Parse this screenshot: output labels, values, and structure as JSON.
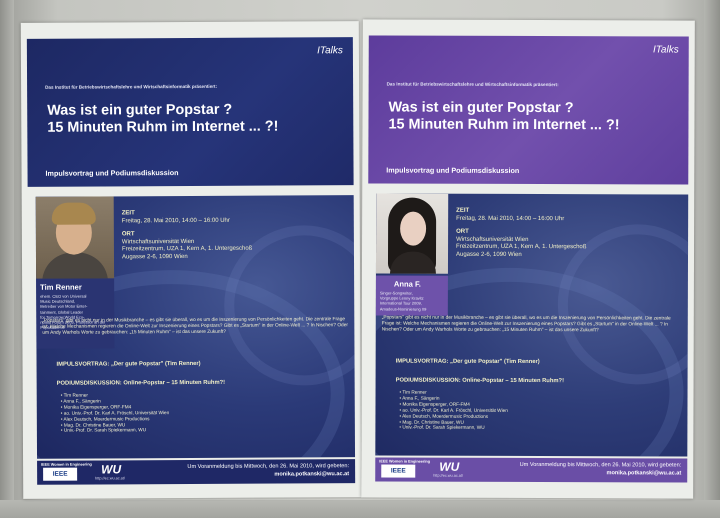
{
  "posters": [
    {
      "brand": "ITalks",
      "intro": "Das Institut für Betriebswirtschaftslehre und Wirtschaftsinformatik präsentiert:",
      "title_line1": "Was ist ein guter Popstar ?",
      "title_line2": "15 Minuten Ruhm im Internet ... ?!",
      "subtitle": "Impulsvortrag und Podiumsdiskussion",
      "speaker_name": "Tim Renner",
      "speaker_bio": "ehem. CEO von Universal\nMusic Deutschland,\nBetreiber von Motor Enter-\ntainment, Global Leader\nfor Tomorrow World Eco-\nnomic Forum 2005, Professor an der Popakademie",
      "zeit_label": "ZEIT",
      "zeit_value": "Freitag, 28. Mai 2010, 14:00 – 16:00 Uhr",
      "ort_label": "ORT",
      "ort_line1": "Wirtschaftsuniversität Wien",
      "ort_line2": "Freizeitzentrum, UZA 1, Kern A, 1. Untergeschoß",
      "ort_line3": "Augasse 2-6, 1090 Wien",
      "paragraph": "„Popstars\" gibt es nicht nur in der Musikbranche – es gibt sie überall, wo es um die Inszenierung von Persönlichkeiten geht. Die zentrale Frage ist: Welche Mechanismen regieren die Online-Welt zur Inszenierung eines Popstars? Gibt es „Startum\" in der Online-Welt ... ? In Nischen? Oder um Andy Warhols Worte zu gebrauchen: „15 Minuten Ruhm\" – ist das unsere Zukunft?",
      "impuls": "IMPULSVORTRAG: „Der gute Popstar\" (Tim Renner)",
      "podium": "PODIUMSDISKUSSION: Online-Popstar – 15 Minuten Ruhm?!",
      "panel": [
        "Tim Renner",
        "Anna F., Sängerin",
        "Monika Eigensperger, ORF-FM4",
        "ao. Univ.-Prof. Dr. Karl A. Fröschl, Universität Wien",
        "Alex Deutsch, Moerdermusic Productions",
        "Mag. Dr. Christine Bauer, WU",
        "Univ.-Prof. Dr. Sarah Spiekermann, WU"
      ],
      "ieee_small": "IEEE Women in Engineering",
      "ieee": "IEEE",
      "wu": "WU",
      "url": "http://ec.wu.ac.at/",
      "reg_text": "Um Voranmeldung bis Mittwoch, den 26. Mai 2010, wird gebeten:",
      "reg_mail": "monika.potkanski@wu.ac.at"
    },
    {
      "brand": "ITalks",
      "intro": "Das Institut für Betriebswirtschaftslehre und Wirtschaftsinformatik präsentiert:",
      "title_line1": "Was ist ein guter Popstar ?",
      "title_line2": "15 Minuten Ruhm im Internet ... ?!",
      "subtitle": "Impulsvortrag und Podiumsdiskussion",
      "speaker_name": "Anna F.",
      "speaker_bio": "Singer-Songwriter,\nVorgruppe Lenny Kravitz\nInternational Tour 2009,\nAmadeus-Nominierung 09",
      "zeit_label": "ZEIT",
      "zeit_value": "Freitag, 28. Mai 2010, 14:00 – 16:00 Uhr",
      "ort_label": "ORT",
      "ort_line1": "Wirtschaftsuniversität Wien",
      "ort_line2": "Freizeitzentrum, UZA 1, Kern A, 1. Untergeschoß",
      "ort_line3": "Augasse 2-6, 1090 Wien",
      "paragraph": "„Popstars\" gibt es nicht nur in der Musikbranche – es gibt sie überall, wo es um die Inszenierung von Persönlichkeiten geht. Die zentrale Frage ist: Welche Mechanismen regieren die Online-Welt zur Inszenierung eines Popstars? Gibt es „Startum\" in der Online-Welt ... ? In Nischen? Oder um Andy Warhols Worte zu gebrauchen: „15 Minuten Ruhm\" – ist das unsere Zukunft?",
      "impuls": "IMPULSVORTRAG: „Der gute Popstar\" (Tim Renner)",
      "podium": "PODIUMSDISKUSSION: Online-Popstar – 15 Minuten Ruhm?!",
      "panel": [
        "Tim Renner",
        "Anna F., Sängerin",
        "Monika Eigensperger, ORF-FM4",
        "ao. Univ.-Prof. Dr. Karl A. Fröschl, Universität Wien",
        "Alex Deutsch, Moerdermusic Productions",
        "Mag. Dr. Christine Bauer, WU",
        "Univ.-Prof. Dr. Sarah Spiekermann, WU"
      ],
      "ieee_small": "IEEE Women in Engineering",
      "ieee": "IEEE",
      "wu": "WU",
      "url": "http://ec.wu.ac.at/",
      "reg_text": "Um Voranmeldung bis Mittwoch, den 26. Mai 2010, wird gebeten:",
      "reg_mail": "monika.potkanski@wu.ac.at"
    }
  ]
}
